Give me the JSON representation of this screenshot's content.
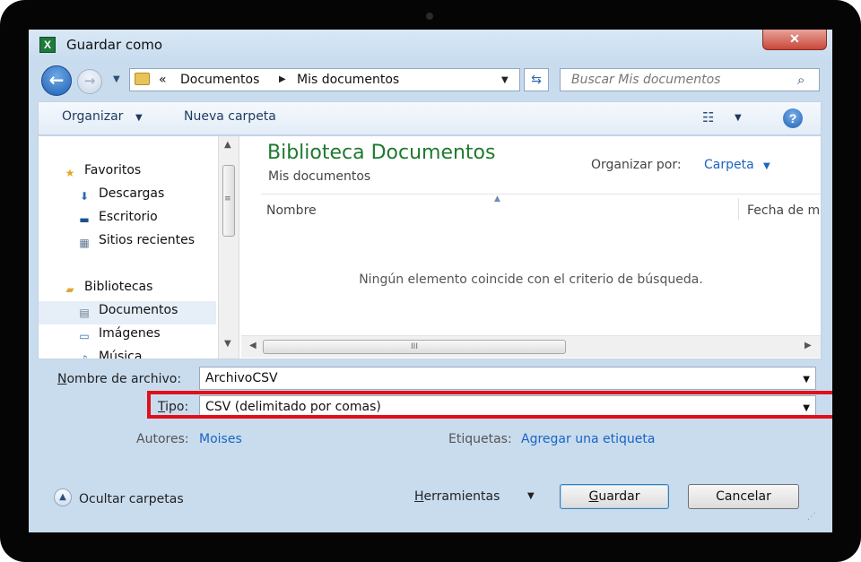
{
  "window": {
    "title": "Guardar como",
    "close_glyph": "✕",
    "app_icon_letter": "X"
  },
  "nav": {
    "back_glyph": "←",
    "forward_glyph": "→",
    "history_caret": "▼",
    "address": {
      "overflow": "«",
      "crumb1": "Documentos",
      "sep": "▶",
      "crumb2": "Mis documentos",
      "dropdown": "▼"
    },
    "refresh_glyph": "⇆",
    "search_placeholder": "Buscar Mis documentos",
    "search_glyph": "⌕"
  },
  "toolbar": {
    "organize": "Organizar",
    "organize_caret": "▼",
    "new_folder": "Nueva carpeta",
    "view_glyph": "☷",
    "view_caret": "▼",
    "help_glyph": "?"
  },
  "sidebar": {
    "scroll_up": "▲",
    "scroll_down": "▼",
    "scroll_grip": "≡",
    "items": [
      {
        "label": "Favoritos",
        "icon": "star-icon",
        "glyph": "★"
      },
      {
        "label": "Descargas",
        "icon": "downloads-folder-icon",
        "glyph": "⬇"
      },
      {
        "label": "Escritorio",
        "icon": "desktop-icon",
        "glyph": "▬"
      },
      {
        "label": "Sitios recientes",
        "icon": "recent-places-icon",
        "glyph": "▦"
      },
      {
        "label": "Bibliotecas",
        "icon": "libraries-icon",
        "glyph": "▰"
      },
      {
        "label": "Documentos",
        "icon": "document-icon",
        "glyph": "▤"
      },
      {
        "label": "Imágenes",
        "icon": "pictures-icon",
        "glyph": "▭"
      },
      {
        "label": "Música",
        "icon": "music-icon",
        "glyph": "♪"
      }
    ]
  },
  "content": {
    "library_title": "Biblioteca Documentos",
    "library_subtitle": "Mis documentos",
    "arrange_label": "Organizar por:",
    "arrange_value": "Carpeta",
    "arrange_caret": "▼",
    "sort_glyph": "▲",
    "col_name": "Nombre",
    "col_date": "Fecha de modificación",
    "empty_message": "Ningún elemento coincide con el criterio de búsqueda.",
    "hscroll_left": "◀",
    "hscroll_right": "▶",
    "hscroll_grip": "III"
  },
  "form": {
    "filename_label_underlined": "N",
    "filename_label_rest": "ombre de archivo:",
    "filename_value": "ArchivoCSV",
    "type_label_underlined": "T",
    "type_label_rest": "ipo:",
    "type_value": "CSV (delimitado por comas)",
    "dropdown_glyph": "▼",
    "authors_label": "Autores:",
    "authors_value": "Moises",
    "tags_label": "Etiquetas:",
    "tags_value": "Agregar una etiqueta"
  },
  "footer": {
    "hide_folders": "Ocultar carpetas",
    "hide_glyph": "▲",
    "tools_underlined": "H",
    "tools_rest": "erramientas",
    "tools_caret": "▼",
    "save_underlined": "G",
    "save_rest": "uardar",
    "cancel": "Cancelar",
    "grip": "⋰"
  },
  "colors": {
    "library_title": "#1e7a2e",
    "link": "#1a64c2",
    "highlight_box": "#e0101a",
    "window_frame": "#c9dcee"
  }
}
